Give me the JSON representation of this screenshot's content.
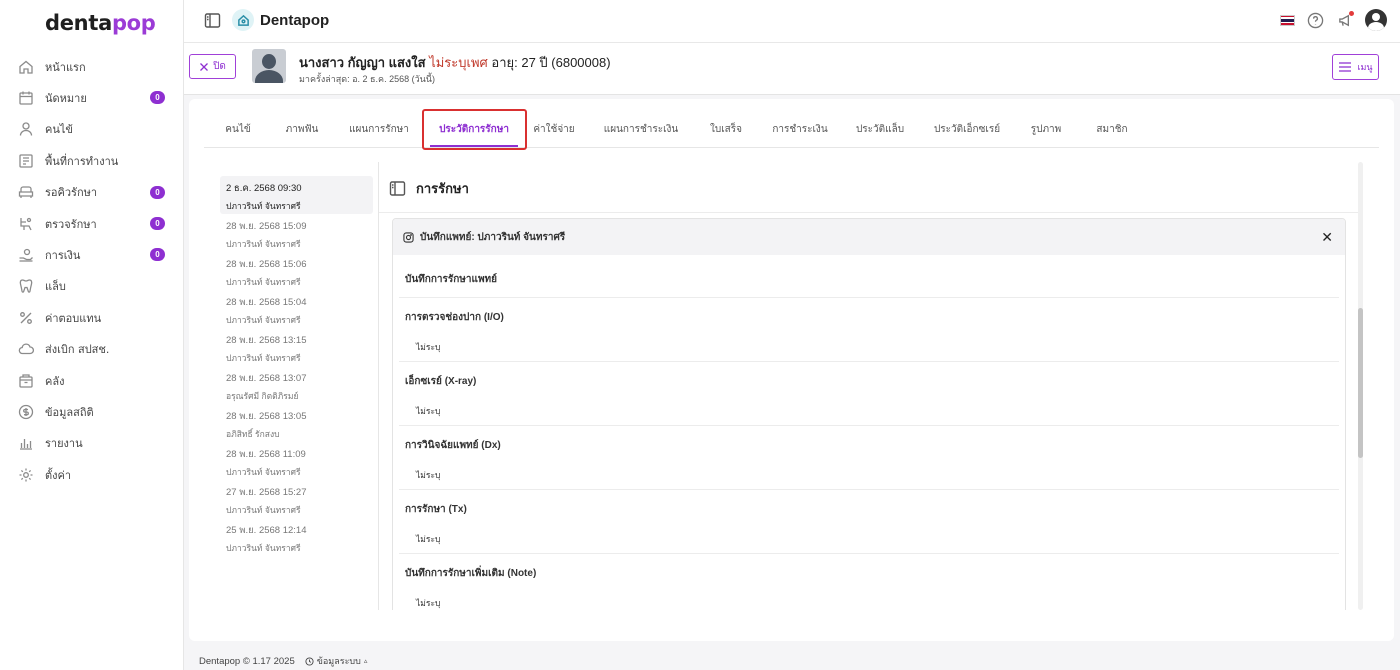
{
  "logo": {
    "part1": "denta",
    "part2": "pop"
  },
  "sidebar": {
    "items": [
      {
        "label": "หน้าแรก",
        "icon": "home-icon"
      },
      {
        "label": "นัดหมาย",
        "icon": "calendar-icon",
        "badge": "0"
      },
      {
        "label": "คนไข้",
        "icon": "user-icon"
      },
      {
        "label": "พื้นที่การทำงาน",
        "icon": "workspace-icon"
      },
      {
        "label": "รอคิวรักษา",
        "icon": "sofa-icon",
        "badge": "0"
      },
      {
        "label": "ตรวจรักษา",
        "icon": "dental-chair-icon",
        "badge": "0"
      },
      {
        "label": "การเงิน",
        "icon": "money-hand-icon",
        "badge": "0"
      },
      {
        "label": "แล็บ",
        "icon": "tooth-icon"
      },
      {
        "label": "ค่าตอบแทน",
        "icon": "percent-icon"
      },
      {
        "label": "ส่งเบิก สปสช.",
        "icon": "cloud-icon"
      },
      {
        "label": "คลัง",
        "icon": "box-icon"
      },
      {
        "label": "ข้อมูลสถิติ",
        "icon": "dollar-circle-icon"
      },
      {
        "label": "รายงาน",
        "icon": "bar-chart-icon"
      },
      {
        "label": "ตั้งค่า",
        "icon": "gear-icon"
      }
    ]
  },
  "topbar": {
    "app_name": "Dentapop"
  },
  "patient": {
    "close_label": "ปิด",
    "name": "นางสาว กัญญา แสงใส",
    "gender": "ไม่ระบุเพศ",
    "age_id": "อายุ: 27 ปี  (6800008)",
    "last_visit": "มาครั้งล่าสุด: อ. 2 ธ.ค. 2568 (วันนี้)",
    "menu_label": "เมนู"
  },
  "tabs": [
    {
      "label": "คนไข้",
      "active": false
    },
    {
      "label": "ภาพฟัน",
      "active": false
    },
    {
      "label": "แผนการรักษา",
      "active": false
    },
    {
      "label": "ประวัติการรักษา",
      "active": true
    },
    {
      "label": "ค่าใช้จ่าย",
      "active": false
    },
    {
      "label": "แผนการชำระเงิน",
      "active": false
    },
    {
      "label": "ใบเสร็จ",
      "active": false
    },
    {
      "label": "การชำระเงิน",
      "active": false
    },
    {
      "label": "ประวัติแล็บ",
      "active": false
    },
    {
      "label": "ประวัติเอ็กซเรย์",
      "active": false
    },
    {
      "label": "รูปภาพ",
      "active": false
    },
    {
      "label": "สมาชิก",
      "active": false
    }
  ],
  "visits": [
    {
      "date": "2 ธ.ค. 2568 09:30",
      "doctor": "ปภาวรินท์ จันทราศรี",
      "active": true
    },
    {
      "date": "28 พ.ย. 2568 15:09",
      "doctor": "ปภาวรินท์ จันทราศรี"
    },
    {
      "date": "28 พ.ย. 2568 15:06",
      "doctor": "ปภาวรินท์ จันทราศรี"
    },
    {
      "date": "28 พ.ย. 2568 15:04",
      "doctor": "ปภาวรินท์ จันทราศรี"
    },
    {
      "date": "28 พ.ย. 2568 13:15",
      "doctor": "ปภาวรินท์ จันทราศรี"
    },
    {
      "date": "28 พ.ย. 2568 13:07",
      "doctor": "อรุณรัศมี กิตติภิรมย์"
    },
    {
      "date": "28 พ.ย. 2568 13:05",
      "doctor": "อภิสิทธิ์ รักสงบ"
    },
    {
      "date": "28 พ.ย. 2568 11:09",
      "doctor": "ปภาวรินท์ จันทราศรี"
    },
    {
      "date": "27 พ.ย. 2568 15:27",
      "doctor": "ปภาวรินท์ จันทราศรี"
    },
    {
      "date": "25 พ.ย. 2568 12:14",
      "doctor": "ปภาวรินท์ จันทราศรี"
    }
  ],
  "detail": {
    "title": "การรักษา",
    "note_header": "บันทึกแพทย์: ปภาวรินท์ จันทราศรี",
    "section_heading": "บันทึกการรักษาแพทย์",
    "sections": [
      {
        "title": "การตรวจช่องปาก (I/O)",
        "value": "ไม่ระบุ"
      },
      {
        "title": "เอ็กซเรย์ (X-ray)",
        "value": "ไม่ระบุ"
      },
      {
        "title": "การวินิจฉัยแพทย์ (Dx)",
        "value": "ไม่ระบุ"
      },
      {
        "title": "การรักษา (Tx)",
        "value": "ไม่ระบุ"
      },
      {
        "title": "บันทึกการรักษาเพิ่มเติม (Note)",
        "value": "ไม่ระบุ"
      }
    ]
  },
  "footer": {
    "copyright": "Dentapop © 1.17 2025",
    "system_info": "ข้อมูลระบบ"
  },
  "colors": {
    "accent": "#8e2fd1",
    "highlight": "#d93030",
    "gender": "#c0392b"
  }
}
